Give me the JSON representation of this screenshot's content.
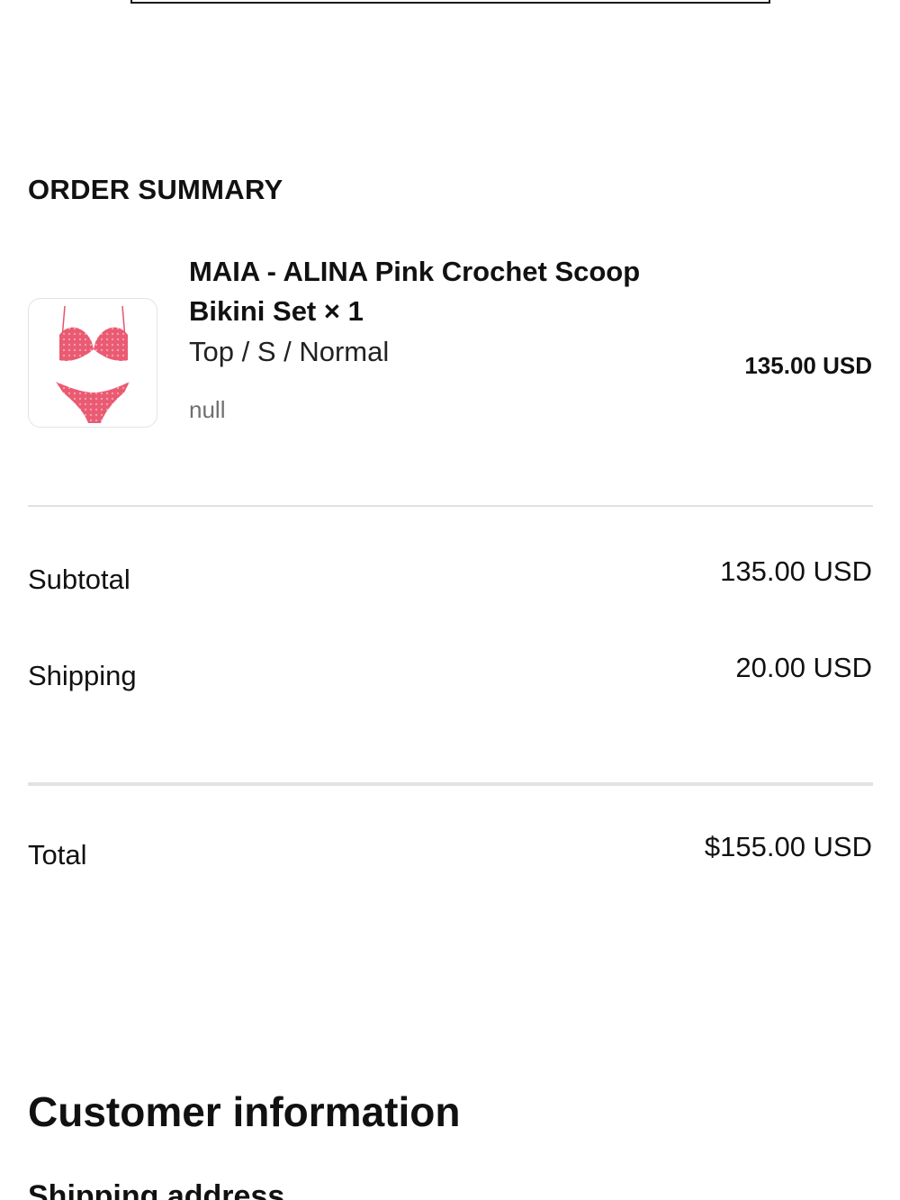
{
  "order_summary": {
    "title": "ORDER SUMMARY",
    "item": {
      "name": "MAIA - ALINA Pink Crochet Scoop Bikini Set × 1",
      "variant": "Top / S / Normal",
      "note": "null",
      "price": "135.00 USD",
      "image_icon": "bikini-product-image",
      "image_color": "#e9526a"
    }
  },
  "totals": {
    "subtotal_label": "Subtotal",
    "subtotal_value": "135.00 USD",
    "shipping_label": "Shipping",
    "shipping_value": "20.00 USD",
    "total_label": "Total",
    "total_value": "$155.00 USD"
  },
  "customer_info": {
    "title": "Customer information",
    "shipping_address_title": "Shipping address"
  },
  "colors": {
    "text": "#111111",
    "muted": "#6f6f6f",
    "divider": "#e2e2e2",
    "accent_pink": "#e9526a"
  }
}
